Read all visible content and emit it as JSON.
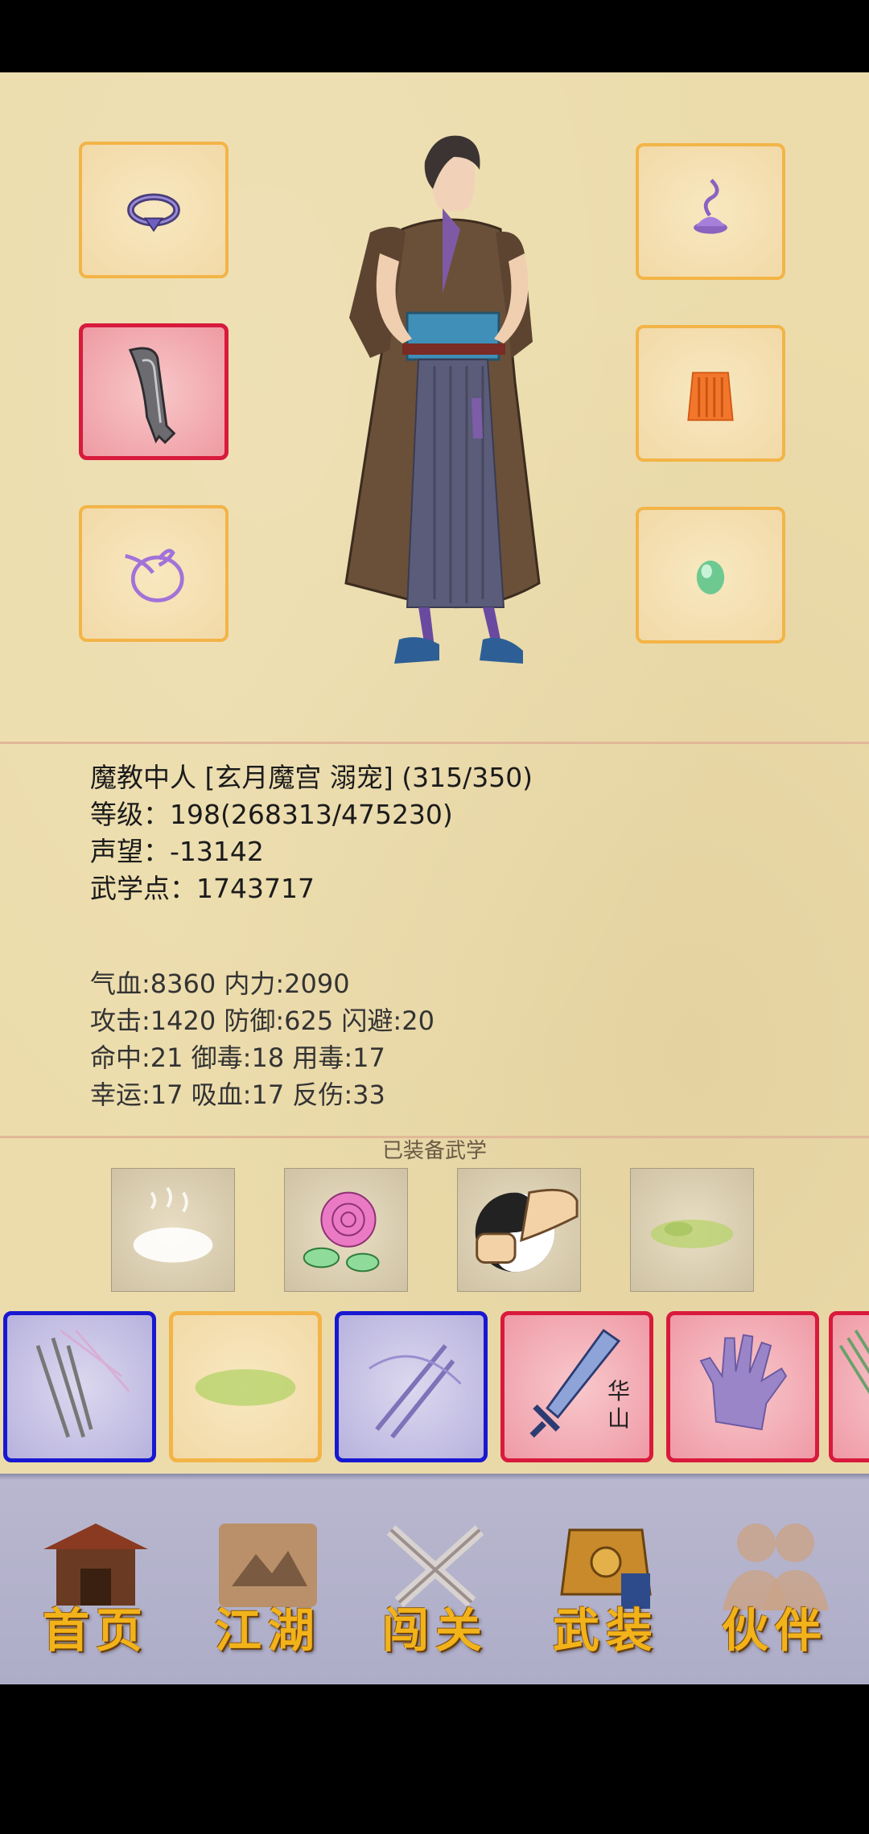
{
  "character": {
    "title": "魔教中人 [玄月魔宫 溺宠] (315/350)",
    "level": "等级：198(268313/475230)",
    "reputation": "声望：-13142",
    "martial_points": "武学点：1743717"
  },
  "stats": {
    "line1": "气血:8360  内力:2090",
    "line2": "攻击:1420  防御:625  闪避:20",
    "line3": "命中:21  御毒:18  用毒:17",
    "line4": "幸运:17  吸血:17  反伤:33"
  },
  "equipped_martial": {
    "title": "已装备武学"
  },
  "martial_strip": {
    "item5_text": "华\n山"
  },
  "nav": {
    "home": "首页",
    "jianghu": "江湖",
    "challenge": "闯关",
    "equipment": "武装",
    "partner": "伙伴"
  },
  "colors": {
    "paper": "#ecdcab",
    "slot_border_orange": "#f3b447",
    "slot_border_red": "#d81a3c",
    "slot_border_blue": "#1818d0",
    "nav_bg": "#aeadc8",
    "nav_text": "#f2b31a"
  },
  "icons": {
    "slot_left_1": "ring-icon",
    "slot_left_2": "sword-icon",
    "slot_left_3": "amulet-icon",
    "slot_right_1": "incense-icon",
    "slot_right_2": "armor-skirt-icon",
    "slot_right_3": "jade-icon"
  }
}
